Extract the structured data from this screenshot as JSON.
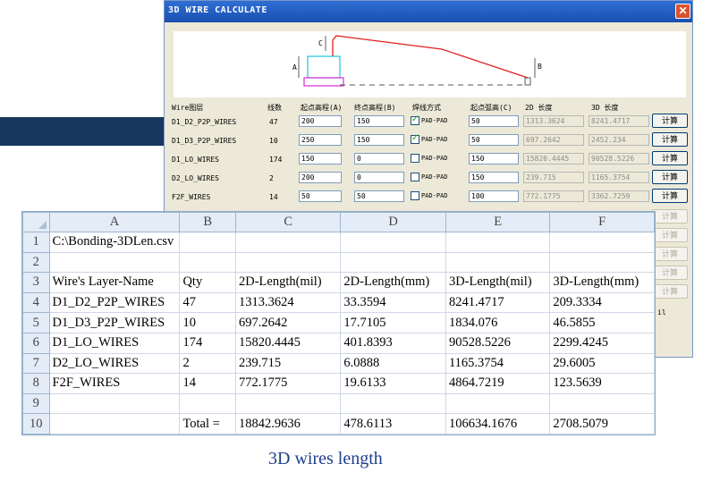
{
  "dialog": {
    "title": "3D WIRE CALCULATE",
    "close": "✕",
    "diagram_labels": {
      "a": "A",
      "b": "B",
      "c": "C"
    },
    "headers": [
      "Wire图层",
      "线数",
      "起点高程(A)",
      "终点高程(B)",
      "焊线方式",
      "起点弧高(C)",
      "2D 长度",
      "3D 长度"
    ],
    "calc_label": "计算",
    "side_text": "il",
    "rows": [
      {
        "layer": "D1_D2_P2P_WIRES",
        "count": "47",
        "start": "200",
        "end": "150",
        "checked": true,
        "mode": "PAD-PAD",
        "arc": "50",
        "len2d": "1313.3624",
        "len3d": "8241.4717"
      },
      {
        "layer": "D1_D3_P2P_WIRES",
        "count": "10",
        "start": "250",
        "end": "150",
        "checked": true,
        "mode": "PAD-PAD",
        "arc": "50",
        "len2d": "697.2642",
        "len3d": "2452.234"
      },
      {
        "layer": "D1_LO_WIRES",
        "count": "174",
        "start": "150",
        "end": "0",
        "checked": false,
        "mode": "PAD-PAD",
        "arc": "150",
        "len2d": "15820.4445",
        "len3d": "90528.5226"
      },
      {
        "layer": "D2_LO_WIRES",
        "count": "2",
        "start": "200",
        "end": "0",
        "checked": false,
        "mode": "PAD-PAD",
        "arc": "150",
        "len2d": "239.715",
        "len3d": "1165.3754"
      },
      {
        "layer": "F2F_WIRES",
        "count": "14",
        "start": "50",
        "end": "50",
        "checked": false,
        "mode": "PAD-PAD",
        "arc": "100",
        "len2d": "772.1775",
        "len3d": "3362.7259"
      }
    ]
  },
  "sheet": {
    "columns": [
      "A",
      "B",
      "C",
      "D",
      "E",
      "F"
    ],
    "rows": [
      [
        "C:\\Bonding-3DLen.csv",
        "",
        "",
        "",
        "",
        ""
      ],
      [
        "",
        "",
        "",
        "",
        "",
        ""
      ],
      [
        "Wire's Layer-Name",
        "Qty",
        "2D-Length(mil)",
        "2D-Length(mm)",
        "3D-Length(mil)",
        "3D-Length(mm)"
      ],
      [
        "D1_D2_P2P_WIRES",
        "47",
        "1313.3624",
        "33.3594",
        "8241.4717",
        "209.3334"
      ],
      [
        "D1_D3_P2P_WIRES",
        "10",
        "697.2642",
        "17.7105",
        "1834.076",
        "46.5855"
      ],
      [
        "D1_LO_WIRES",
        "174",
        "15820.4445",
        "401.8393",
        "90528.5226",
        "2299.4245"
      ],
      [
        "D2_LO_WIRES",
        "2",
        "239.715",
        "6.0888",
        "1165.3754",
        "29.6005"
      ],
      [
        "F2F_WIRES",
        "14",
        "772.1775",
        "19.6133",
        "4864.7219",
        "123.5639"
      ],
      [
        "",
        "",
        "",
        "",
        "",
        ""
      ],
      [
        "",
        "Total =",
        "18842.9636",
        "478.6113",
        "106634.1676",
        "2708.5079"
      ]
    ]
  },
  "caption": "3D wires length"
}
